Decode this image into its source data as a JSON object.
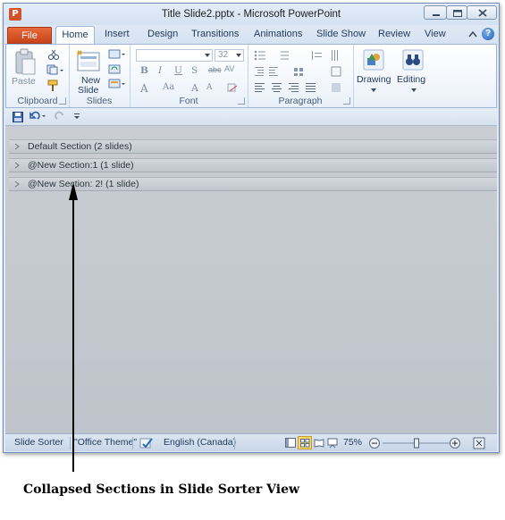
{
  "window": {
    "title": "Title Slide2.pptx - Microsoft PowerPoint",
    "app_icon_letter": "P"
  },
  "tabs": [
    {
      "label": "File"
    },
    {
      "label": "Home"
    },
    {
      "label": "Insert"
    },
    {
      "label": "Design"
    },
    {
      "label": "Transitions"
    },
    {
      "label": "Animations"
    },
    {
      "label": "Slide Show"
    },
    {
      "label": "Review"
    },
    {
      "label": "View"
    }
  ],
  "ribbon": {
    "clipboard": {
      "label": "Clipboard",
      "paste": "Paste"
    },
    "slides": {
      "label": "Slides",
      "new_slide_1": "New",
      "new_slide_2": "Slide"
    },
    "font": {
      "label": "Font",
      "size": "32"
    },
    "paragraph": {
      "label": "Paragraph"
    },
    "drawing": {
      "label": "Drawing"
    },
    "editing": {
      "label": "Editing"
    }
  },
  "sections": [
    {
      "label": "Default Section (2 slides)"
    },
    {
      "label": "@New Section:1 (1 slide)"
    },
    {
      "label": "@New Section: 2! (1 slide)"
    }
  ],
  "status": {
    "view": "Slide Sorter",
    "theme": "\"Office Theme\"",
    "language": "English (Canada)",
    "zoom": "75%",
    "zoom_level": 0.5
  },
  "caption": "Collapsed Sections in Slide Sorter View",
  "colors": {
    "file_tab": "#d0532b",
    "workarea": "#c3c8cf",
    "ribbon_text": "#1e395b"
  }
}
